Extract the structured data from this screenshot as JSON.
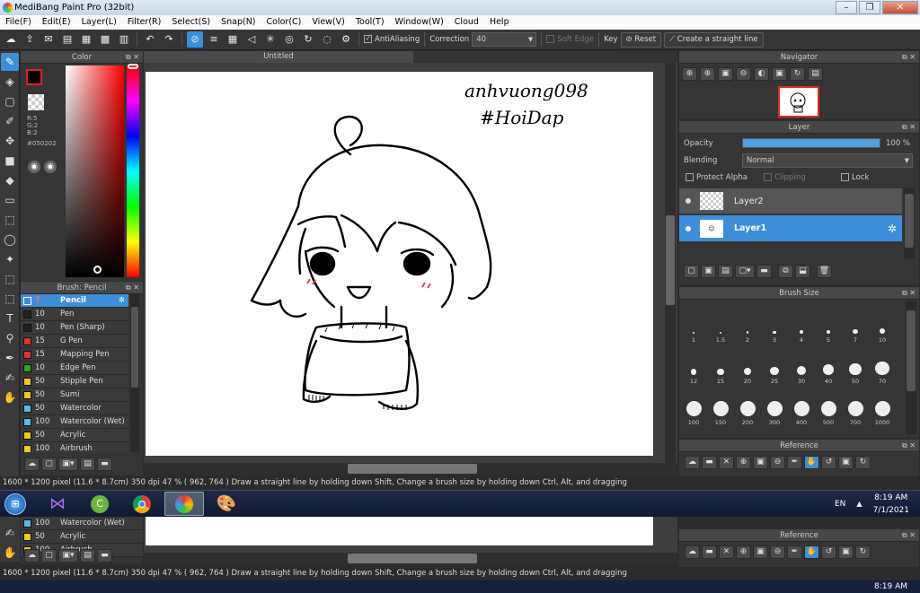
{
  "window": {
    "title": "MediBang Paint Pro (32bit)"
  },
  "menu": [
    "File(F)",
    "Edit(E)",
    "Layer(L)",
    "Filter(R)",
    "Select(S)",
    "Snap(N)",
    "Color(C)",
    "View(V)",
    "Tool(T)",
    "Window(W)",
    "Cloud",
    "Help"
  ],
  "toolbar": {
    "antialiasing_label": "AntiAliasing",
    "correction_label": "Correction",
    "correction_value": "40",
    "soft_edge_label": "Soft Edge",
    "key_label": "Key",
    "reset_label": "Reset",
    "straight_line_label": "Create a straight line"
  },
  "color_panel": {
    "title": "Color",
    "r": "R:5",
    "g": "G:2",
    "b": "B:2",
    "hex": "#050202",
    "primary": "#050202",
    "hue": "#ff0000"
  },
  "brush_panel": {
    "title": "Brush: Pencil",
    "items": [
      {
        "size": "7",
        "name": "Pencil",
        "color": "#3d8ed8",
        "active": true
      },
      {
        "size": "10",
        "name": "Pen",
        "color": "#222222"
      },
      {
        "size": "10",
        "name": "Pen (Sharp)",
        "color": "#222222"
      },
      {
        "size": "15",
        "name": "G Pen",
        "color": "#dd3333"
      },
      {
        "size": "15",
        "name": "Mapping Pen",
        "color": "#dd3333"
      },
      {
        "size": "10",
        "name": "Edge Pen",
        "color": "#22aa22"
      },
      {
        "size": "50",
        "name": "Stipple Pen",
        "color": "#eecc11"
      },
      {
        "size": "50",
        "name": "Sumi",
        "color": "#eecc11"
      },
      {
        "size": "50",
        "name": "Watercolor",
        "color": "#55bbee"
      },
      {
        "size": "100",
        "name": "Watercolor (Wet)",
        "color": "#55bbee"
      },
      {
        "size": "50",
        "name": "Acrylic",
        "color": "#eecc11"
      },
      {
        "size": "100",
        "name": "Airbrush",
        "color": "#eecc11"
      }
    ]
  },
  "canvas": {
    "tab_title": "Untitled",
    "watermark_line1": "anhvuong098",
    "watermark_line2": "#HoiDap"
  },
  "navigator": {
    "title": "Navigator"
  },
  "layer_panel": {
    "title": "Layer",
    "opacity_label": "Opacity",
    "opacity_value": "100 %",
    "opacity": 1.0,
    "blending_label": "Blending",
    "blending_value": "Normal",
    "protect_alpha_label": "Protect Alpha",
    "clipping_label": "Clipping",
    "lock_label": "Lock",
    "layers": [
      {
        "name": "Layer2",
        "active": false
      },
      {
        "name": "Layer1",
        "active": true
      }
    ]
  },
  "brush_size": {
    "title": "Brush Size",
    "sizes": [
      "1",
      "1.5",
      "2",
      "3",
      "4",
      "5",
      "7",
      "10",
      "12",
      "15",
      "20",
      "25",
      "30",
      "40",
      "50",
      "70",
      "100",
      "150",
      "200",
      "300",
      "400",
      "500",
      "700",
      "1000"
    ]
  },
  "reference": {
    "title": "Reference"
  },
  "status": {
    "text": "1600 * 1200 pixel   (11.6 * 8.7cm)   350 dpi   47 %   ( 962, 764 )   Draw a straight line by holding down Shift, Change a brush size by holding down Ctrl, Alt, and dragging"
  },
  "taskbar": {
    "lang": "EN",
    "time": "8:19 AM",
    "date": "7/1/2021"
  }
}
